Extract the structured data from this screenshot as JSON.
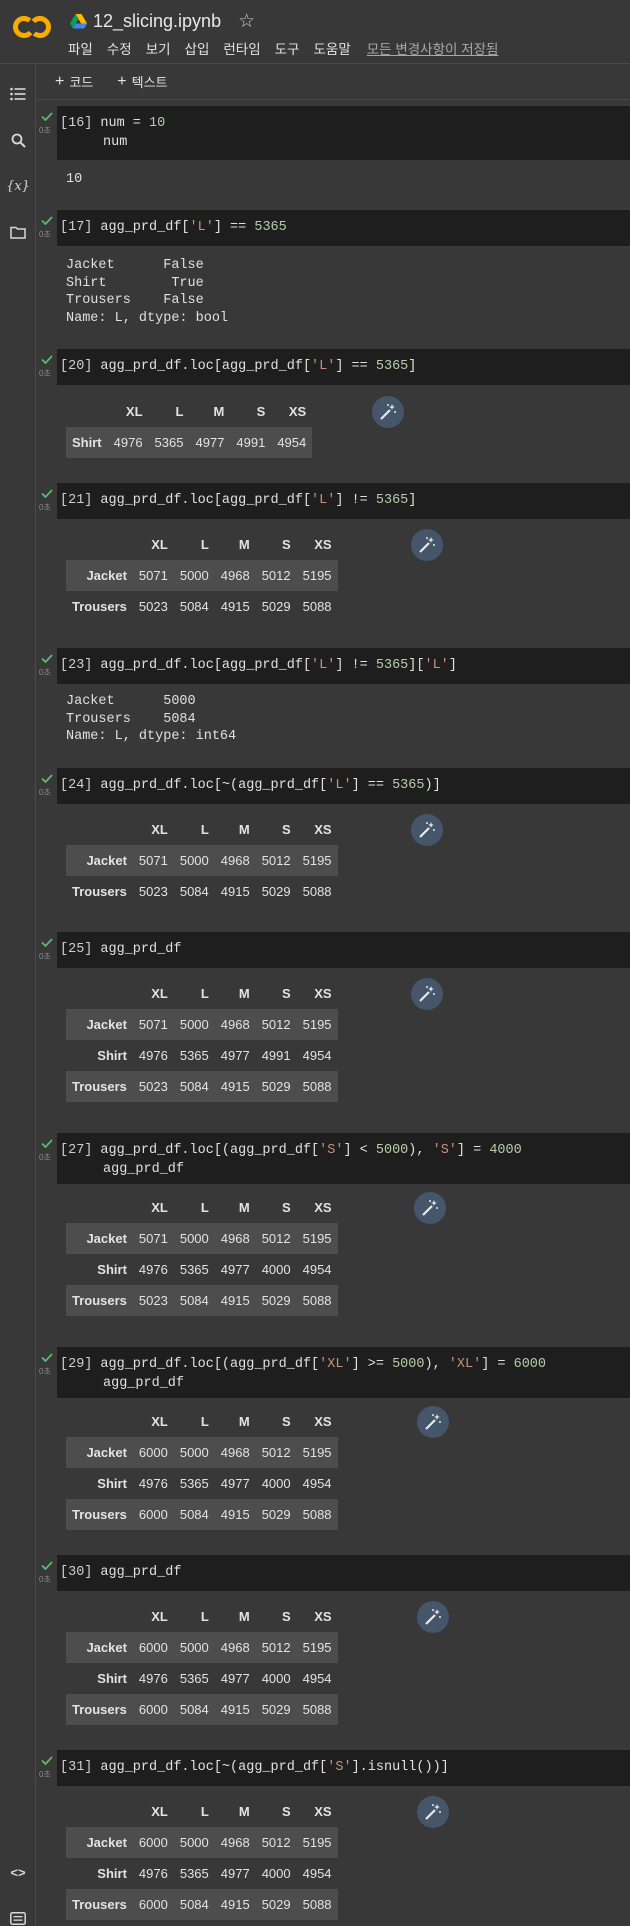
{
  "title": "12_slicing.ipynb",
  "menus": [
    "파일",
    "수정",
    "보기",
    "삽입",
    "런타임",
    "도구",
    "도움말"
  ],
  "saved": "모든 변경사항이 저장됨",
  "toolbar": {
    "code": "코드",
    "text": "텍스트"
  },
  "exec_time": "0초",
  "icons": {
    "sidebar": [
      "toc-icon",
      "search-icon",
      "variables-icon",
      "folder-icon",
      "code-snippets-icon",
      "terminal-icon"
    ],
    "variables_glyph": "{x}",
    "code_glyph": "<>"
  },
  "cells": {
    "c16": {
      "num": "[16]",
      "out": "10"
    },
    "c17": {
      "num": "[17]",
      "out": "Jacket      False\nShirt        True\nTrousers    False\nName: L, dtype: bool"
    },
    "c20": {
      "num": "[20]"
    },
    "c21": {
      "num": "[21]"
    },
    "c23": {
      "num": "[23]",
      "out": "Jacket      5000\nTrousers    5084\nName: L, dtype: int64"
    },
    "c24": {
      "num": "[24]"
    },
    "c25": {
      "num": "[25]"
    },
    "c27": {
      "num": "[27]"
    },
    "c29": {
      "num": "[29]"
    },
    "c30": {
      "num": "[30]"
    },
    "c31": {
      "num": "[31]"
    }
  },
  "columns": [
    "XL",
    "L",
    "M",
    "S",
    "XS"
  ],
  "tables": {
    "t20": [
      [
        "Shirt",
        "4976",
        "5365",
        "4977",
        "4991",
        "4954"
      ]
    ],
    "t21": [
      [
        "Jacket",
        "5071",
        "5000",
        "4968",
        "5012",
        "5195"
      ],
      [
        "Trousers",
        "5023",
        "5084",
        "4915",
        "5029",
        "5088"
      ]
    ],
    "t24": [
      [
        "Jacket",
        "5071",
        "5000",
        "4968",
        "5012",
        "5195"
      ],
      [
        "Trousers",
        "5023",
        "5084",
        "4915",
        "5029",
        "5088"
      ]
    ],
    "t25": [
      [
        "Jacket",
        "5071",
        "5000",
        "4968",
        "5012",
        "5195"
      ],
      [
        "Shirt",
        "4976",
        "5365",
        "4977",
        "4991",
        "4954"
      ],
      [
        "Trousers",
        "5023",
        "5084",
        "4915",
        "5029",
        "5088"
      ]
    ],
    "t27": [
      [
        "Jacket",
        "5071",
        "5000",
        "4968",
        "5012",
        "5195"
      ],
      [
        "Shirt",
        "4976",
        "5365",
        "4977",
        "4000",
        "4954"
      ],
      [
        "Trousers",
        "5023",
        "5084",
        "4915",
        "5029",
        "5088"
      ]
    ],
    "t29": [
      [
        "Jacket",
        "6000",
        "5000",
        "4968",
        "5012",
        "5195"
      ],
      [
        "Shirt",
        "4976",
        "5365",
        "4977",
        "4000",
        "4954"
      ],
      [
        "Trousers",
        "6000",
        "5084",
        "4915",
        "5029",
        "5088"
      ]
    ],
    "t30": [
      [
        "Jacket",
        "6000",
        "5000",
        "4968",
        "5012",
        "5195"
      ],
      [
        "Shirt",
        "4976",
        "5365",
        "4977",
        "4000",
        "4954"
      ],
      [
        "Trousers",
        "6000",
        "5084",
        "4915",
        "5029",
        "5088"
      ]
    ],
    "t31": [
      [
        "Jacket",
        "6000",
        "5000",
        "4968",
        "5012",
        "5195"
      ],
      [
        "Shirt",
        "4976",
        "5365",
        "4977",
        "4000",
        "4954"
      ],
      [
        "Trousers",
        "6000",
        "5084",
        "4915",
        "5029",
        "5088"
      ]
    ]
  },
  "colors": {
    "bg": "#383838",
    "code_bg": "#1e1e1e",
    "ok": "#5cba6e",
    "magic_bg": "#45556a",
    "number": "#b5cea8",
    "string": "#ce9178"
  }
}
